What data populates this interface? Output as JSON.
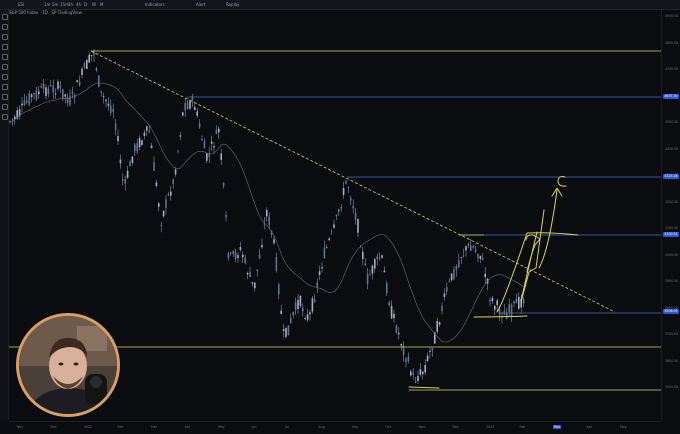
{
  "topbar": {
    "items": [
      "ESI",
      "1m",
      "5m",
      "15m",
      "1h",
      "4h",
      "D",
      "W",
      "M",
      "Indicators",
      "Alert",
      "Replay"
    ]
  },
  "symbol": {
    "label": "S&P 500 Index · 1D · SP  TradingView"
  },
  "price_axis": {
    "labels": [
      "4900.00",
      "4800.00",
      "4700.00",
      "4600.00",
      "4500.00",
      "4400.00",
      "4300.00",
      "4200.00",
      "4100.00",
      "4000.00",
      "3900.00",
      "3800.00",
      "3700.00",
      "3600.00",
      "3500.00"
    ],
    "tags": [
      {
        "text": "4637.30",
        "color": "#2a5bd7"
      },
      {
        "text": "4325.28",
        "color": "#2a5bd7"
      },
      {
        "text": "4100.51",
        "color": "#2a5bd7"
      },
      {
        "text": "3906.05",
        "color": "#2a5bd7"
      }
    ]
  },
  "time_axis": {
    "labels": [
      "Nov",
      "Dec",
      "2022",
      "Feb",
      "Mar",
      "Apr",
      "May",
      "Jun",
      "Jul",
      "Aug",
      "Sep",
      "Oct",
      "Nov",
      "Dec",
      "2023",
      "Feb",
      "Mar",
      "Apr",
      "May"
    ],
    "highlight": "Mar"
  },
  "colors": {
    "line_yellow": "#d8d35a",
    "line_blue": "#3a6fd8",
    "candle": "#9fb3c8",
    "ma": "#6a6e75",
    "background": "#0b0c10"
  },
  "webcam": {
    "description": "presenter-webcam"
  }
}
